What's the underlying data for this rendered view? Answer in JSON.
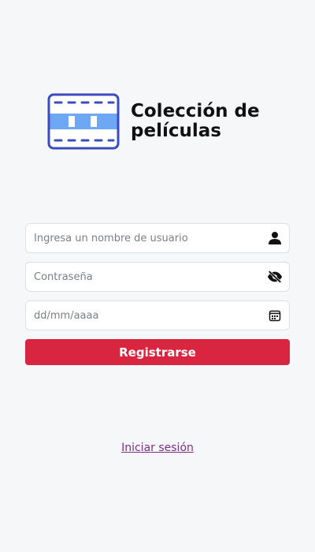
{
  "app": {
    "title": "Colección de películas",
    "accent_color": "#d92640",
    "logo_color": "#3b4cc0"
  },
  "form": {
    "username": {
      "placeholder": "Ingresa un nombre de usuario",
      "value": "",
      "icon": "person-icon"
    },
    "password": {
      "placeholder": "Contraseña",
      "value": "",
      "icon": "eye-slash-icon"
    },
    "date": {
      "placeholder": "dd/mm/aaaa",
      "value": "",
      "icon": "calendar-icon"
    },
    "submit_label": "Registrarse"
  },
  "login_link": "Iniciar sesión"
}
